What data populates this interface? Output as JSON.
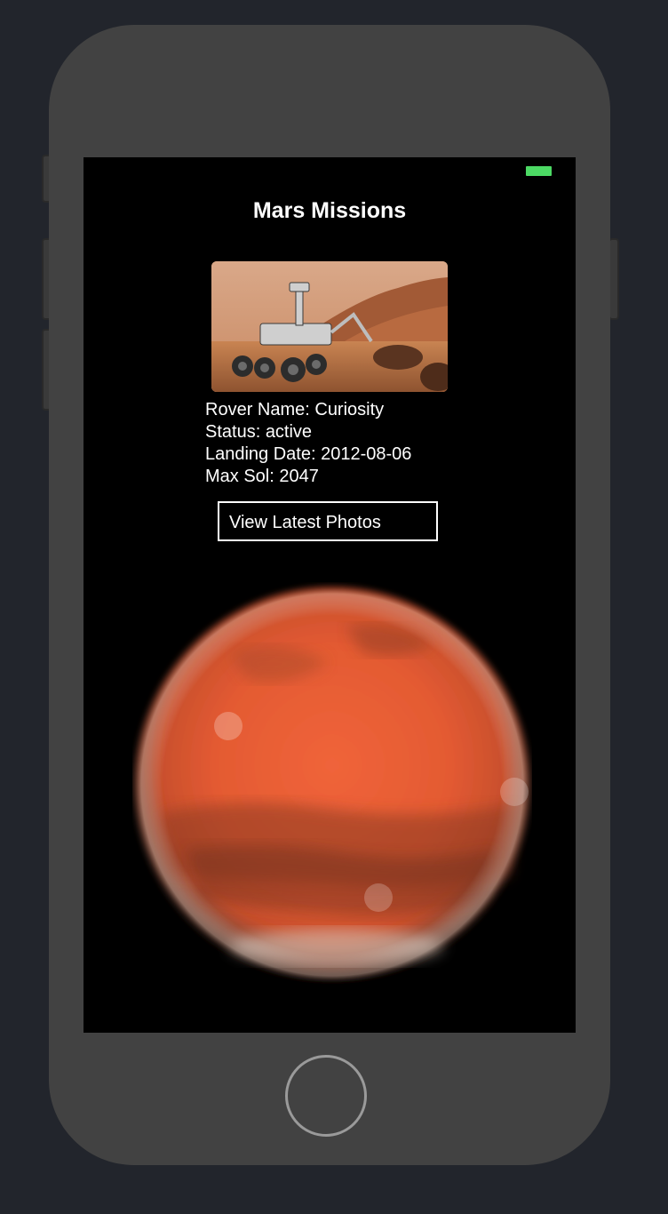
{
  "app": {
    "title": "Mars Missions"
  },
  "status_bar": {
    "battery_color": "#4cd964"
  },
  "rover": {
    "name_line": "Rover Name: Curiosity",
    "status_line": "Status: active",
    "landing_line": "Landing Date: 2012-08-06",
    "max_sol_line": "Max Sol: 2047"
  },
  "actions": {
    "view_photos_label": "View Latest Photos"
  },
  "images": {
    "rover_photo": "curiosity-rover-photo",
    "planet": "mars-planet-image"
  },
  "device": {
    "home_button": "home-button"
  }
}
